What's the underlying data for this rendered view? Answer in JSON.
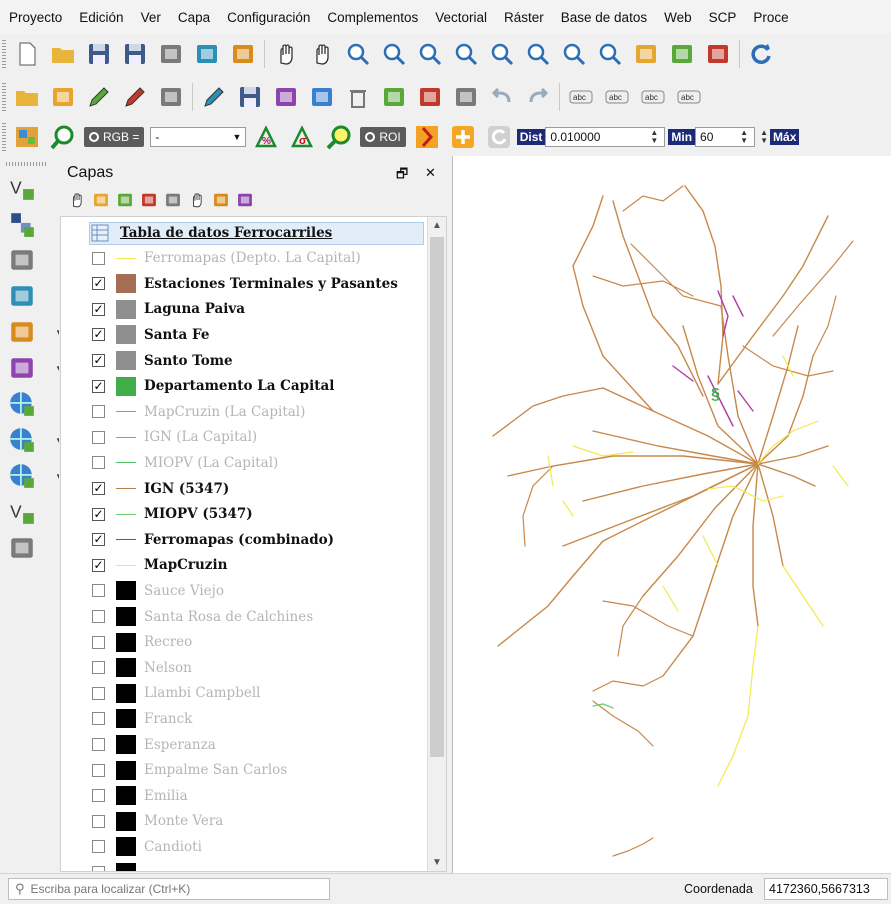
{
  "menu": [
    "Proyecto",
    "Edición",
    "Ver",
    "Capa",
    "Configuración",
    "Complementos",
    "Vectorial",
    "Ráster",
    "Base de datos",
    "Web",
    "SCP",
    "Proce"
  ],
  "toolbar1_icons": [
    "new-project-icon",
    "open-project-icon",
    "save-project-icon",
    "save-as-icon",
    "new-print-layout-icon",
    "layout-manager-icon",
    "style-manager-icon",
    "pan-icon",
    "pan-to-selection-icon",
    "zoom-in-icon",
    "zoom-out-icon",
    "zoom-native-icon",
    "zoom-full-icon",
    "zoom-to-selection-icon",
    "zoom-to-layer-icon",
    "zoom-last-icon",
    "zoom-next-icon",
    "new-map-view-icon",
    "new-3d-view-icon",
    "bookmarks-icon",
    "refresh-icon"
  ],
  "toolbar2_icons": [
    "open-data-source-manager-icon",
    "add-layer-icon",
    "digitize-icon",
    "current-edits-icon",
    "toggle-editing-icon",
    "pencil-icon",
    "save-edits-icon",
    "add-record-icon",
    "modify-attributes-icon",
    "delete-selected-icon",
    "cut-features-icon",
    "copy-features-icon",
    "paste-features-icon",
    "undo-icon",
    "redo-icon",
    "label-abc-icon",
    "pin-labels-icon",
    "highlight-labels-icon",
    "move-label-icon"
  ],
  "scp_toolbar": {
    "rgb_label": "RGB =",
    "rgb_value": "-",
    "roi_label": "ROI",
    "dist_label": "Dist",
    "dist_value": "0.010000",
    "min_label": "Min",
    "min_value": "60",
    "max_label": "Máx"
  },
  "left_toolbar_icons": [
    "add-vector-layer-icon",
    "add-raster-layer-icon",
    "add-delimited-text-icon",
    "add-spatialite-layer-icon",
    "add-postgis-layer-icon",
    "add-mssql-layer-icon",
    "add-wms-layer-icon",
    "add-wcs-layer-icon",
    "add-wfs-layer-icon",
    "new-shapefile-layer-icon",
    "new-temporary-layer-icon"
  ],
  "layers_panel": {
    "title": "Capas",
    "float_glyph": "🗗",
    "close_glyph": "✕",
    "tool_icons": [
      "style-panel-icon",
      "add-group-icon",
      "manage-visibility-icon",
      "filter-legend-icon",
      "filter-expression-icon",
      "expand-all-icon",
      "collapse-all-icon",
      "remove-layer-icon"
    ],
    "layers": [
      {
        "name": "Tabla de datos Ferrocarriles",
        "type": "table",
        "selected": true
      },
      {
        "name": "Ferromapas (Depto. La Capital)",
        "checked": false,
        "symbol": "line",
        "color": "#f2e94c"
      },
      {
        "name": "Estaciones Terminales y Pasantes",
        "checked": true,
        "symbol": "fill",
        "color": "#a46d54"
      },
      {
        "name": "Laguna Paiva",
        "checked": true,
        "symbol": "fill",
        "color": "#8f8f8f"
      },
      {
        "name": "Santa Fe",
        "checked": true,
        "symbol": "fill",
        "color": "#8f8f8f"
      },
      {
        "name": "Santo Tome",
        "checked": true,
        "symbol": "fill",
        "color": "#8f8f8f"
      },
      {
        "name": "Departamento La Capital",
        "checked": true,
        "symbol": "fill",
        "color": "#3fae49"
      },
      {
        "name": "MapCruzin (La Capital)",
        "checked": false,
        "symbol": "line",
        "color": "#58c46a"
      },
      {
        "name": "IGN (La Capital)",
        "checked": false,
        "symbol": "line",
        "color": "#58c46a"
      },
      {
        "name": "MIOPV (La Capital)",
        "checked": false,
        "symbol": "line",
        "color": "#58c46a"
      },
      {
        "name": "IGN (5347)",
        "checked": true,
        "symbol": "line",
        "color": "#b8824c"
      },
      {
        "name": "MIOPV (5347)",
        "checked": true,
        "symbol": "line",
        "color": "#6fcf6a"
      },
      {
        "name": "Ferromapas (combinado)",
        "checked": true,
        "symbol": "line",
        "color": "#9b2fa5"
      },
      {
        "name": "MapCruzin",
        "checked": true,
        "symbol": "line",
        "color": "#f2e94c"
      },
      {
        "name": "Sauce Viejo",
        "checked": false,
        "symbol": "fill",
        "color": "#000000"
      },
      {
        "name": "Santa Rosa de Calchines",
        "checked": false,
        "symbol": "fill",
        "color": "#000000"
      },
      {
        "name": "Recreo",
        "checked": false,
        "symbol": "fill",
        "color": "#000000"
      },
      {
        "name": "Nelson",
        "checked": false,
        "symbol": "fill",
        "color": "#000000"
      },
      {
        "name": "Llambi Campbell",
        "checked": false,
        "symbol": "fill",
        "color": "#000000"
      },
      {
        "name": "Franck",
        "checked": false,
        "symbol": "fill",
        "color": "#000000"
      },
      {
        "name": "Esperanza",
        "checked": false,
        "symbol": "fill",
        "color": "#000000"
      },
      {
        "name": "Empalme San Carlos",
        "checked": false,
        "symbol": "fill",
        "color": "#000000"
      },
      {
        "name": "Emilia",
        "checked": false,
        "symbol": "fill",
        "color": "#000000"
      },
      {
        "name": "Monte Vera",
        "checked": false,
        "symbol": "fill",
        "color": "#000000"
      },
      {
        "name": "Candioti",
        "checked": false,
        "symbol": "fill",
        "color": "#000000"
      },
      {
        "name": "",
        "checked": false,
        "symbol": "fill",
        "color": "#000000"
      }
    ]
  },
  "statusbar": {
    "search_placeholder": "Escriba para localizar (Ctrl+K)",
    "coord_label": "Coordenada",
    "coord_value": "4172360,5667313"
  },
  "colors": {
    "rail_ign": "#c8884a",
    "rail_mapcruzin": "#f2e94c",
    "rail_ferromapas": "#b03aa8",
    "accent_blue": "#2d6db5"
  }
}
